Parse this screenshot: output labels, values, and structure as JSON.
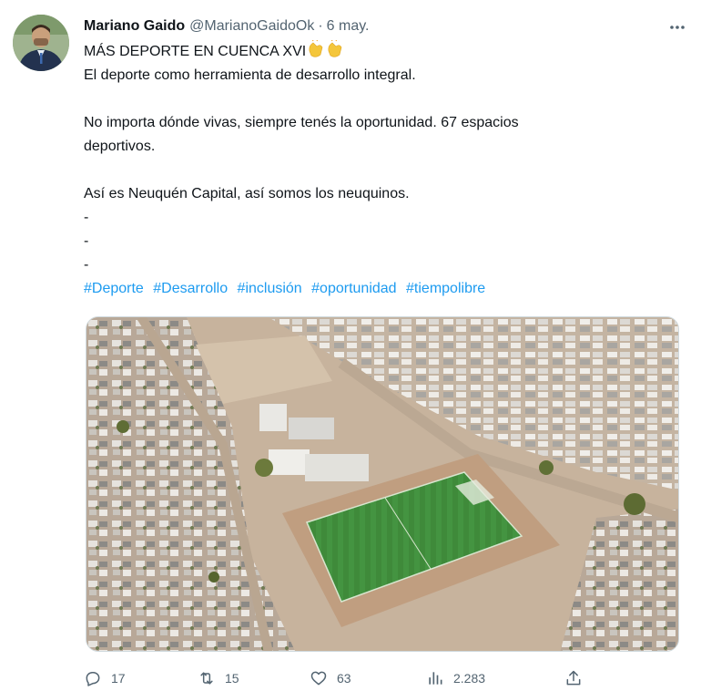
{
  "author": {
    "name": "Mariano Gaido",
    "handle": "@MarianoGaidoOk",
    "separator": "·",
    "date": "6 may."
  },
  "body": {
    "line1": "MÁS DEPORTE EN CUENCA XVI",
    "line1_emoji": "clapping-hands x2",
    "line2": "El deporte como herramienta de desarrollo integral.",
    "line3a": "No importa dónde vivas, siempre tenés la oportunidad.  67 espacios",
    "line3b": "deportivos.",
    "line4": "Así es Neuquén Capital, así somos los neuquinos.",
    "dash1": "-",
    "dash2": "-",
    "dash3": "-"
  },
  "hashtags": [
    "#Deporte",
    "#Desarrollo",
    "#inclusión",
    "#oportunidad",
    "#tiempolibre"
  ],
  "actions": {
    "replies": "17",
    "retweets": "15",
    "likes": "63",
    "views": "2.283"
  },
  "colors": {
    "link": "#1d9bf0",
    "secondary_text": "#536471",
    "field_green": "#3f8a3a"
  },
  "icons": [
    "more-icon",
    "reply-icon",
    "retweet-icon",
    "like-icon",
    "views-icon",
    "share-icon",
    "clap-emoji-icon"
  ]
}
